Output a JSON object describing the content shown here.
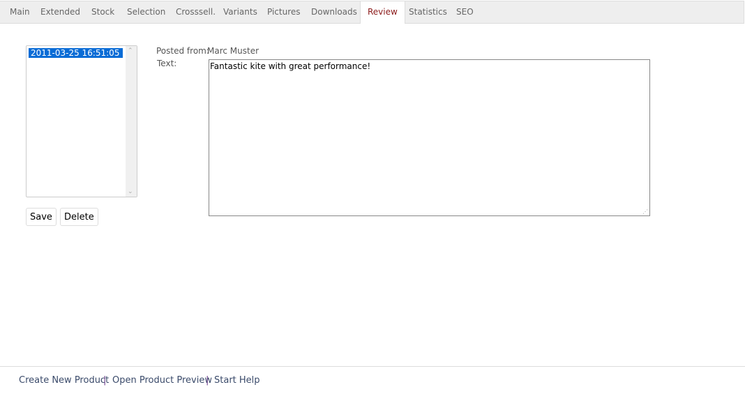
{
  "tabs": [
    {
      "label": "Main"
    },
    {
      "label": "Extended"
    },
    {
      "label": "Stock"
    },
    {
      "label": "Selection"
    },
    {
      "label": "Crosssell."
    },
    {
      "label": "Variants"
    },
    {
      "label": "Pictures"
    },
    {
      "label": "Downloads"
    },
    {
      "label": "Review",
      "active": true
    },
    {
      "label": "Statistics"
    },
    {
      "label": "SEO"
    }
  ],
  "review_list": {
    "items": [
      "2011-03-25 16:51:05"
    ],
    "selected": "2011-03-25 16:51:05"
  },
  "buttons": {
    "save": "Save",
    "delete": "Delete"
  },
  "details": {
    "posted_from_label": "Posted from:",
    "posted_from_value": "Marc Muster",
    "text_label": "Text:",
    "text_value": "Fantastic kite with great performance!"
  },
  "footer": {
    "links": [
      "Create New Product",
      "Open Product Preview",
      "Start Help"
    ],
    "separator": "|"
  },
  "colors": {
    "active_tab": "#8b1a1a",
    "selection": "#0a6cd6"
  }
}
